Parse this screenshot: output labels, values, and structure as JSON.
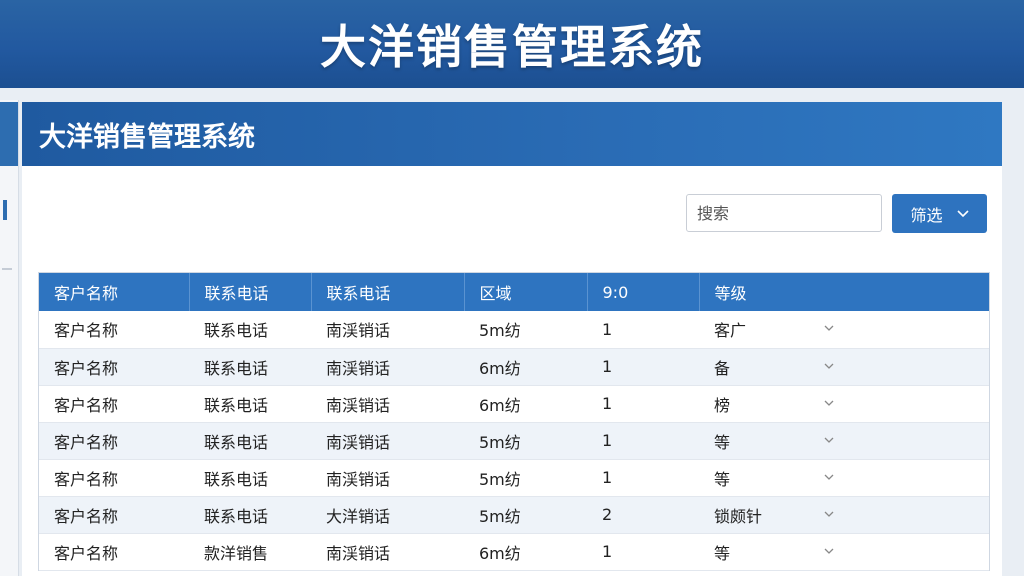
{
  "banner": {
    "title": "大洋销售管理系统"
  },
  "panel": {
    "title": "大洋销售管理系统"
  },
  "toolbar": {
    "search_placeholder": "搜索",
    "filter_label": "筛选",
    "filter_icon": "chevron-down-icon"
  },
  "table": {
    "columns": [
      "客户名称",
      "联系电话",
      "联系电话",
      "区域",
      "9:0",
      "等级"
    ],
    "rows": [
      [
        "客户名称",
        "联系电话",
        "南渓销话",
        "5m纺",
        "1",
        "客广"
      ],
      [
        "客户名称",
        "联系电话",
        "南渓销话",
        "6m纺",
        "1",
        "备"
      ],
      [
        "客户名称",
        "联系电话",
        "南渓销话",
        "6m纺",
        "1",
        "榜"
      ],
      [
        "客户名称",
        "联系电话",
        "南渓销话",
        "5m纺",
        "1",
        "等"
      ],
      [
        "客户名称",
        "联系电话",
        "南渓销话",
        "5m纺",
        "1",
        "等"
      ],
      [
        "客户名称",
        "联系电话",
        "大洋销话",
        "5m纺",
        "2",
        "锁颇针"
      ],
      [
        "客户名称",
        "款洋销售",
        "南渓销话",
        "6m纺",
        "1",
        "等"
      ]
    ]
  },
  "colors": {
    "banner": "#2259a0",
    "header": "#2a6cb5",
    "table_header": "#2e74c0",
    "row_alt": "#eef3f9"
  }
}
